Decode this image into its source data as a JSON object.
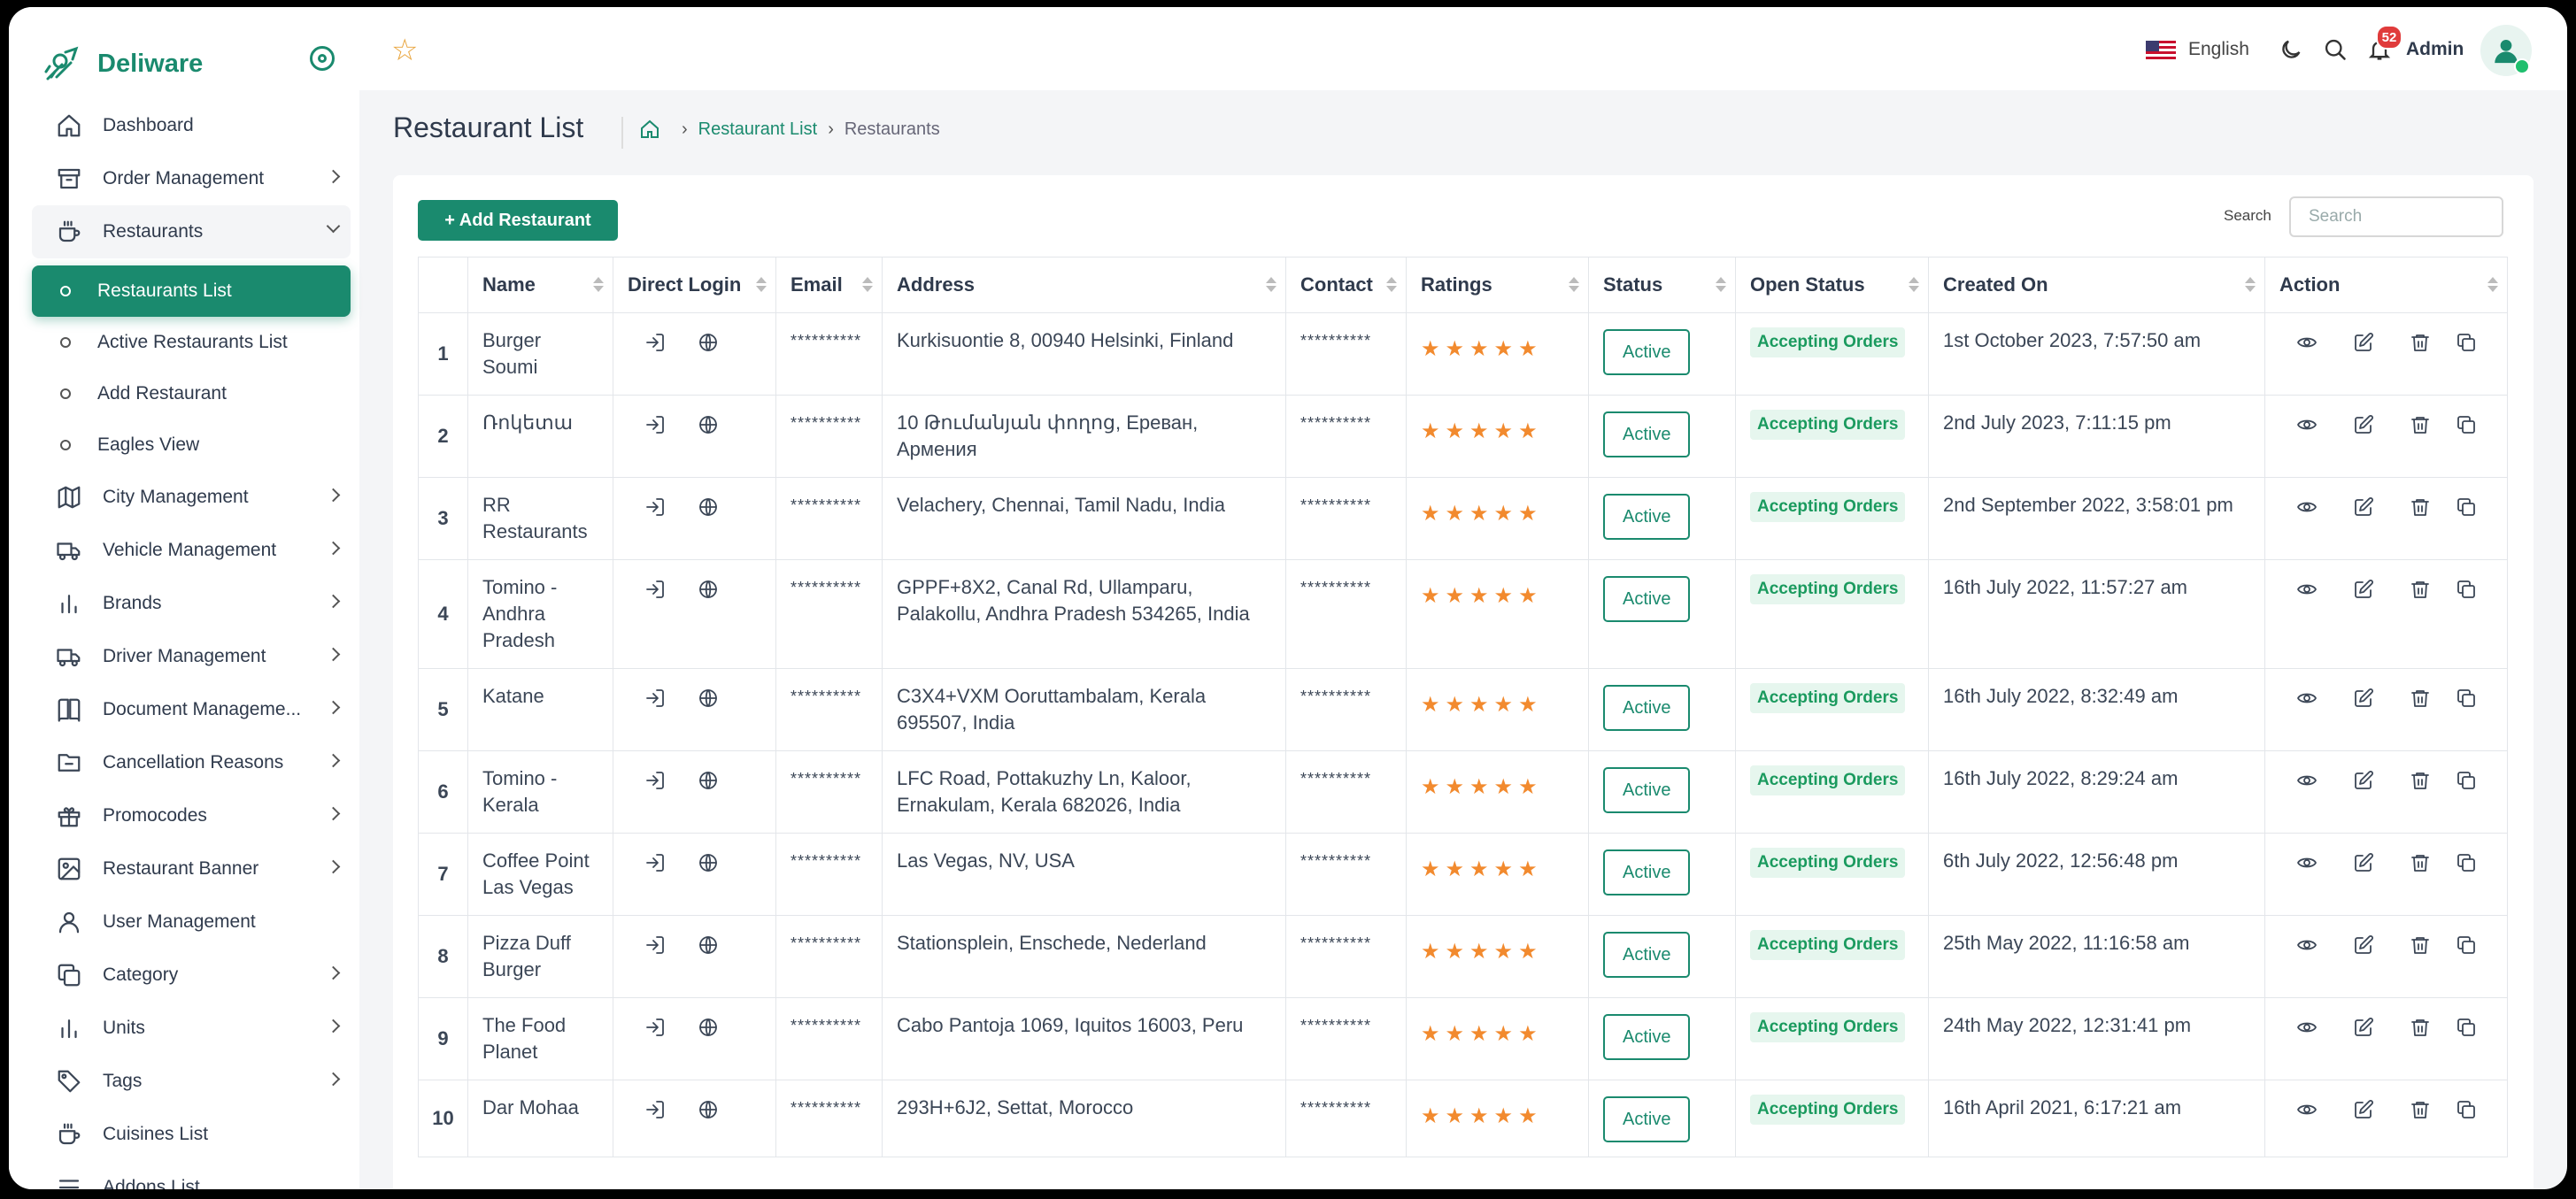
{
  "app": {
    "brand_name": "Deliware",
    "accent_color": "#1a8a6e"
  },
  "sidebar": {
    "items": [
      {
        "label": "Dashboard",
        "icon": "home-icon",
        "has_submenu": false
      },
      {
        "label": "Order Management",
        "icon": "archive-icon",
        "has_submenu": true
      },
      {
        "label": "Restaurants",
        "icon": "coffee-cup-icon",
        "has_submenu": true,
        "expanded": true
      }
    ],
    "restaurant_subitems": [
      {
        "label": "Restaurants List",
        "active": true
      },
      {
        "label": "Active Restaurants List",
        "active": false
      },
      {
        "label": "Add Restaurant",
        "active": false
      },
      {
        "label": "Eagles View",
        "active": false
      }
    ],
    "more_items": [
      {
        "label": "City Management",
        "icon": "map-icon",
        "has_submenu": true
      },
      {
        "label": "Vehicle Management",
        "icon": "truck-icon",
        "has_submenu": true
      },
      {
        "label": "Brands",
        "icon": "bar-chart-icon",
        "has_submenu": true
      },
      {
        "label": "Driver Management",
        "icon": "truck-icon",
        "has_submenu": true
      },
      {
        "label": "Document Manageme...",
        "icon": "book-icon",
        "has_submenu": true
      },
      {
        "label": "Cancellation Reasons",
        "icon": "folder-minus-icon",
        "has_submenu": true
      },
      {
        "label": "Promocodes",
        "icon": "gift-icon",
        "has_submenu": true
      },
      {
        "label": "Restaurant Banner",
        "icon": "image-icon",
        "has_submenu": true
      },
      {
        "label": "User Management",
        "icon": "user-icon",
        "has_submenu": false
      },
      {
        "label": "Category",
        "icon": "copy-icon",
        "has_submenu": true
      },
      {
        "label": "Units",
        "icon": "bar-chart-icon",
        "has_submenu": true
      },
      {
        "label": "Tags",
        "icon": "tag-icon",
        "has_submenu": true
      },
      {
        "label": "Cuisines List",
        "icon": "coffee-cup-icon",
        "has_submenu": false
      },
      {
        "label": "Addons List",
        "icon": "list-icon",
        "has_submenu": false
      }
    ]
  },
  "topbar": {
    "language": "English",
    "notification_count": "52",
    "user_name": "Admin"
  },
  "page": {
    "title": "Restaurant List",
    "breadcrumb": {
      "link": "Restaurant List",
      "current": "Restaurants"
    },
    "add_button": "+ Add Restaurant",
    "search_label": "Search",
    "search_placeholder": "Search"
  },
  "table": {
    "columns": [
      "",
      "Name",
      "Direct Login",
      "Email",
      "Address",
      "Contact",
      "Ratings",
      "Status",
      "Open Status",
      "Created On",
      "Action"
    ],
    "rows": [
      {
        "num": "1",
        "name": "Burger Soumi",
        "email": "**********",
        "address": "Kurkisuontie 8, 00940 Helsinki, Finland",
        "contact": "**********",
        "rating": 5,
        "status": "Active",
        "open_status": "Accepting Orders",
        "created": "1st October 2023, 7:57:50 am"
      },
      {
        "num": "2",
        "name": "Ռոկետա",
        "email": "**********",
        "address": "10 Թումանյան փողոց, Ереван, Армения",
        "contact": "**********",
        "rating": 5,
        "status": "Active",
        "open_status": "Accepting Orders",
        "created": "2nd July 2023, 7:11:15 pm"
      },
      {
        "num": "3",
        "name": "RR Restaurants",
        "email": "**********",
        "address": "Velachery, Chennai, Tamil Nadu, India",
        "contact": "**********",
        "rating": 5,
        "status": "Active",
        "open_status": "Accepting Orders",
        "created": "2nd September 2022, 3:58:01 pm"
      },
      {
        "num": "4",
        "name": "Tomino - Andhra Pradesh",
        "email": "**********",
        "address": "GPPF+8X2, Canal Rd, Ullamparu, Palakollu, Andhra Pradesh 534265, India",
        "contact": "**********",
        "rating": 5,
        "status": "Active",
        "open_status": "Accepting Orders",
        "created": "16th July 2022, 11:57:27 am"
      },
      {
        "num": "5",
        "name": "Katane",
        "email": "**********",
        "address": "C3X4+VXM Ooruttambalam, Kerala 695507, India",
        "contact": "**********",
        "rating": 5,
        "status": "Active",
        "open_status": "Accepting Orders",
        "created": "16th July 2022, 8:32:49 am"
      },
      {
        "num": "6",
        "name": "Tomino - Kerala",
        "email": "**********",
        "address": "LFC Road, Pottakuzhy Ln, Kaloor, Ernakulam, Kerala 682026, India",
        "contact": "**********",
        "rating": 5,
        "status": "Active",
        "open_status": "Accepting Orders",
        "created": "16th July 2022, 8:29:24 am"
      },
      {
        "num": "7",
        "name": "Coffee Point Las Vegas",
        "email": "**********",
        "address": "Las Vegas, NV, USA",
        "contact": "**********",
        "rating": 5,
        "status": "Active",
        "open_status": "Accepting Orders",
        "created": "6th July 2022, 12:56:48 pm"
      },
      {
        "num": "8",
        "name": "Pizza Duff Burger",
        "email": "**********",
        "address": "Stationsplein, Enschede, Nederland",
        "contact": "**********",
        "rating": 5,
        "status": "Active",
        "open_status": "Accepting Orders",
        "created": "25th May 2022, 11:16:58 am"
      },
      {
        "num": "9",
        "name": "The Food Planet",
        "email": "**********",
        "address": "Cabo Pantoja 1069, Iquitos 16003, Peru",
        "contact": "**********",
        "rating": 5,
        "status": "Active",
        "open_status": "Accepting Orders",
        "created": "24th May 2022, 12:31:41 pm"
      },
      {
        "num": "10",
        "name": "Dar Mohaa",
        "email": "**********",
        "address": "293H+6J2, Settat, Morocco",
        "contact": "**********",
        "rating": 5,
        "status": "Active",
        "open_status": "Accepting Orders",
        "created": "16th April 2021, 6:17:21 am"
      }
    ]
  }
}
